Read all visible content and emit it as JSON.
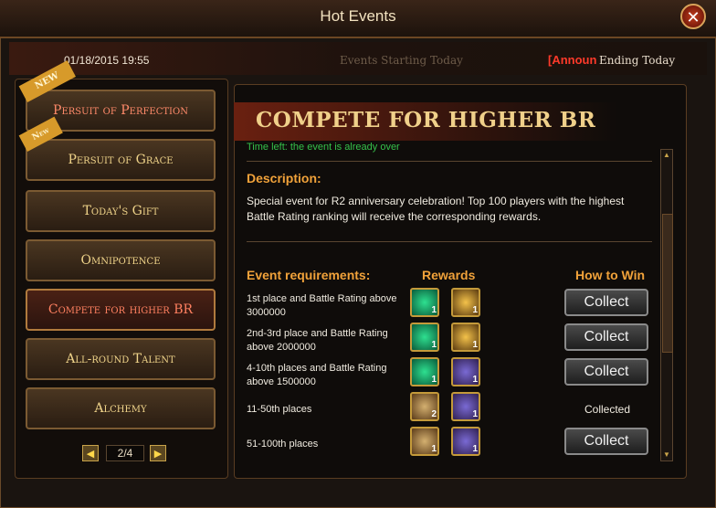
{
  "window": {
    "title": "Hot Events",
    "close": "✕"
  },
  "infobar": {
    "datetime": "01/18/2015 19:55",
    "starting_today": "Events Starting Today",
    "announ": "[Announ",
    "ending_today": "Ending Today"
  },
  "sidebar": {
    "items": [
      {
        "label": "Persuit of Perfection",
        "badge": "NEW"
      },
      {
        "label": "Persuit of Grace",
        "badge": "New"
      },
      {
        "label": "Today's Gift"
      },
      {
        "label": "Omnipotence"
      },
      {
        "label": "Compete for higher BR"
      },
      {
        "label": "All-round Talent"
      },
      {
        "label": "Alchemy"
      }
    ],
    "pager": {
      "text": "2/4",
      "prev": "◀",
      "next": "▶"
    }
  },
  "event": {
    "title": "COMPETE FOR HIGHER BR",
    "time_left": "Time left: the event is already over",
    "description_header": "Description:",
    "description": "Special event for R2 anniversary celebration! Top 100 players with the highest Battle Rating ranking will receive the corresponding rewards.",
    "columns": {
      "requirements": "Event requirements:",
      "rewards": "Rewards",
      "how_to_win": "How to Win"
    },
    "rows": [
      {
        "requirement": "1st place and Battle Rating above 3000000",
        "rewards": [
          {
            "icon": "gem-icon",
            "count": "1"
          },
          {
            "icon": "book-icon",
            "count": "1"
          }
        ],
        "action": "Collect"
      },
      {
        "requirement": "2nd-3rd place and Battle Rating above 2000000",
        "rewards": [
          {
            "icon": "gem-icon",
            "count": "1"
          },
          {
            "icon": "book-icon",
            "count": "1"
          }
        ],
        "action": "Collect"
      },
      {
        "requirement": "4-10th places and Battle Rating above 1500000",
        "rewards": [
          {
            "icon": "gem-icon",
            "count": "1"
          },
          {
            "icon": "horn-icon",
            "count": "1"
          }
        ],
        "action": "Collect"
      },
      {
        "requirement": "11-50th places",
        "rewards": [
          {
            "icon": "chest-icon",
            "count": "2"
          },
          {
            "icon": "horn-icon",
            "count": "1"
          }
        ],
        "status": "Collected"
      },
      {
        "requirement": "51-100th places",
        "rewards": [
          {
            "icon": "chest-icon",
            "count": "1"
          },
          {
            "icon": "horn-icon",
            "count": "1"
          }
        ],
        "action": "Collect"
      }
    ]
  },
  "colors": {
    "accent": "#f1a23a",
    "title_gold": "#f0d08a",
    "active_red": "#ff8060",
    "announ_red": "#ff3a2a",
    "time_green": "#35c04a"
  }
}
